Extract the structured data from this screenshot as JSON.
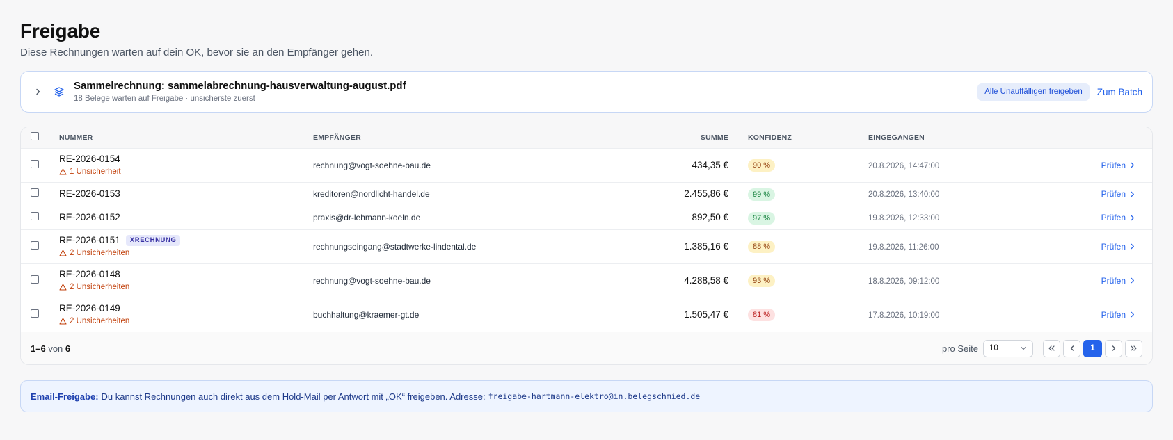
{
  "page": {
    "title": "Freigabe",
    "subtitle": "Diese Rechnungen warten auf dein OK, bevor sie an den Empfänger gehen."
  },
  "batch": {
    "title": "Sammelrechnung: sammelabrechnung-hausverwaltung-august.pdf",
    "subtitle": "18 Belege warten auf Freigabe · unsicherste zuerst",
    "approve_label": "Alle Unauffälligen freigeben",
    "open_label": "Zum Batch"
  },
  "table": {
    "headers": {
      "nummer": "NUMMER",
      "empfaenger": "EMPFÄNGER",
      "summe": "SUMME",
      "konfidenz": "KONFIDENZ",
      "eingegangen": "EINGEGANGEN"
    },
    "action_label": "Prüfen",
    "rows": [
      {
        "nummer": "RE-2026-0154",
        "tag": "",
        "warning": "1 Unsicherheit",
        "empfaenger": "rechnung@vogt-soehne-bau.de",
        "summe": "434,35 €",
        "konfidenz": "90 %",
        "level": "amber",
        "eingegangen": "20.8.2026, 14:47:00"
      },
      {
        "nummer": "RE-2026-0153",
        "tag": "",
        "warning": "",
        "empfaenger": "kreditoren@nordlicht-handel.de",
        "summe": "2.455,86 €",
        "konfidenz": "99 %",
        "level": "green",
        "eingegangen": "20.8.2026, 13:40:00"
      },
      {
        "nummer": "RE-2026-0152",
        "tag": "",
        "warning": "",
        "empfaenger": "praxis@dr-lehmann-koeln.de",
        "summe": "892,50 €",
        "konfidenz": "97 %",
        "level": "green",
        "eingegangen": "19.8.2026, 12:33:00"
      },
      {
        "nummer": "RE-2026-0151",
        "tag": "XRECHNUNG",
        "warning": "2 Unsicherheiten",
        "empfaenger": "rechnungseingang@stadtwerke-lindental.de",
        "summe": "1.385,16 €",
        "konfidenz": "88 %",
        "level": "amber",
        "eingegangen": "19.8.2026, 11:26:00"
      },
      {
        "nummer": "RE-2026-0148",
        "tag": "",
        "warning": "2 Unsicherheiten",
        "empfaenger": "rechnung@vogt-soehne-bau.de",
        "summe": "4.288,58 €",
        "konfidenz": "93 %",
        "level": "amber",
        "eingegangen": "18.8.2026, 09:12:00"
      },
      {
        "nummer": "RE-2026-0149",
        "tag": "",
        "warning": "2 Unsicherheiten",
        "empfaenger": "buchhaltung@kraemer-gt.de",
        "summe": "1.505,47 €",
        "konfidenz": "81 %",
        "level": "red",
        "eingegangen": "17.8.2026, 10:19:00"
      }
    ]
  },
  "footer": {
    "range": "1–6",
    "of_label": "von",
    "total": "6",
    "per_page_label": "pro Seite",
    "per_page_value": "10",
    "current_page": "1"
  },
  "info": {
    "label": "Email-Freigabe:",
    "text": "Du kannst Rechnungen auch direkt aus dem Hold-Mail per Antwort mit „OK“ freigeben. Adresse:",
    "address": "freigabe-hartmann-elektro@in.belegschmied.de"
  },
  "colors": {
    "accent": "#2563eb",
    "warning": "#c2410c"
  }
}
